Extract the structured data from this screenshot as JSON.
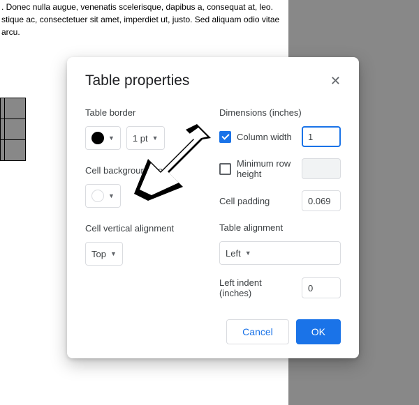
{
  "doc": {
    "line1": ". Donec nulla augue, venenatis scelerisque, dapibus a, consequat at, leo.",
    "line2": "stique ac, consectetuer sit amet, imperdiet ut, justo. Sed aliquam odio vitae",
    "line3": " arcu."
  },
  "modal": {
    "title": "Table properties",
    "left": {
      "table_border_label": "Table border",
      "border_size": "1 pt",
      "cell_bg_label": "Cell background co",
      "vert_align_label": "Cell vertical alignment",
      "vert_align_value": "Top"
    },
    "right": {
      "dimensions_label": "Dimensions  (inches)",
      "col_width_label": "Column width",
      "col_width_value": "1",
      "min_row_label": "Minimum row height",
      "min_row_value": "",
      "cell_padding_label": "Cell padding",
      "cell_padding_value": "0.069",
      "table_align_label": "Table alignment",
      "table_align_value": "Left",
      "left_indent_label": "Left indent  (inches)",
      "left_indent_value": "0"
    },
    "footer": {
      "cancel": "Cancel",
      "ok": "OK"
    }
  }
}
